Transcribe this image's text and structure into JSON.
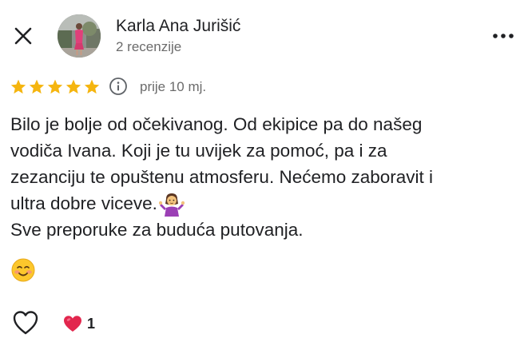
{
  "reviewer": {
    "name": "Karla Ana Jurišić",
    "review_count": "2 recenzije"
  },
  "review": {
    "rating": 5,
    "max_rating": 5,
    "date": "prije 10 mj.",
    "lines": [
      "Bilo je bolje od očekivanog. Od ekipice pa do našeg",
      "vodiča Ivana. Koji je tu uvijek za pomoć, pa i za",
      "zezanciju te opuštenu atmosferu. Nećemo zaboravit i",
      "ultra dobre viceve.",
      "Sve preporuke za buduća putovanja."
    ]
  },
  "reactions": {
    "heart_count": "1"
  },
  "icons": {
    "close": "close-icon",
    "more": "more-icon",
    "info": "info-icon",
    "like": "heart-outline-icon",
    "reaction": "red-heart-icon",
    "shrug_emoji": "woman-shrugging-emoji",
    "smile_emoji": "smiling-face-emoji"
  },
  "colors": {
    "star": "#f5b50f",
    "secondary_text": "#6b6b6b",
    "heart": "#e2264d"
  }
}
